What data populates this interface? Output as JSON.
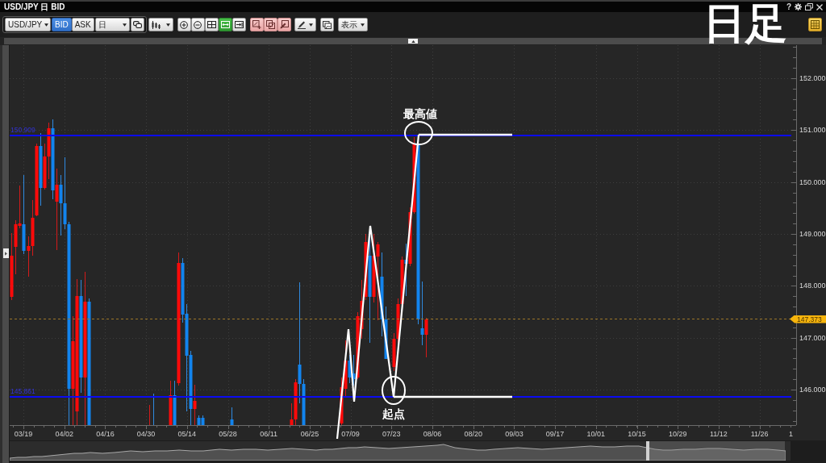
{
  "window": {
    "title": "USD/JPY 日 BID",
    "help": "?"
  },
  "caption": "日足",
  "toolbar": {
    "symbol": "USD/JPY",
    "sides": [
      {
        "label": "BID",
        "selected": true
      },
      {
        "label": "ASK",
        "selected": false
      }
    ],
    "period": "日",
    "zoom_tools": [
      {
        "selected": false
      },
      {
        "selected": false
      },
      {
        "selected": false
      },
      {
        "selected": true
      },
      {
        "selected": false
      }
    ],
    "view_menu": "表示"
  },
  "top_panel": {
    "expanded": true
  },
  "chart": {
    "horizontal_lines": [
      {
        "label": "150.909"
      },
      {
        "label": "145.861"
      }
    ],
    "current_price": "147.373",
    "price_labels": [
      "152.000",
      "151.000",
      "150.000",
      "149.000",
      "148.000",
      "147.000",
      "146.000"
    ],
    "date_labels": [
      "03/19",
      "04/02",
      "04/16",
      "04/30",
      "05/14",
      "05/28",
      "06/11",
      "06/25",
      "07/09",
      "07/23",
      "08/06",
      "08/20",
      "09/03",
      "09/17",
      "10/01",
      "10/15",
      "10/29",
      "11/12",
      "11/26",
      "1"
    ],
    "annotations": [
      {
        "kind": "high",
        "label": "最高値"
      },
      {
        "kind": "start",
        "label": "起点"
      }
    ]
  }
}
